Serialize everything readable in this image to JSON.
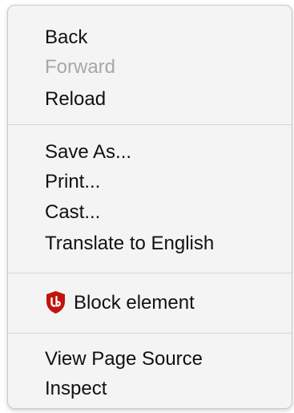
{
  "menu": {
    "groups": [
      {
        "items": [
          {
            "label": "Back",
            "enabled": true
          },
          {
            "label": "Forward",
            "enabled": false
          },
          {
            "label": "Reload",
            "enabled": true
          }
        ]
      },
      {
        "items": [
          {
            "label": "Save As...",
            "enabled": true
          },
          {
            "label": "Print...",
            "enabled": true
          },
          {
            "label": "Cast...",
            "enabled": true
          },
          {
            "label": "Translate to English",
            "enabled": true
          }
        ]
      },
      {
        "items": [
          {
            "label": "Block element",
            "enabled": true,
            "icon": "ublock-origin-icon"
          }
        ]
      },
      {
        "items": [
          {
            "label": "View Page Source",
            "enabled": true
          },
          {
            "label": "Inspect",
            "enabled": true
          }
        ]
      }
    ]
  },
  "colors": {
    "text": "#111111",
    "disabled_text": "#a8a8a8",
    "menu_background": "#f4f4f4",
    "ublock_red": "#c2140f"
  }
}
